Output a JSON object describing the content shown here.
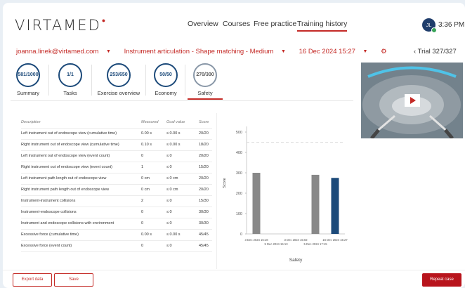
{
  "header": {
    "logo_text": "VIRTAMED",
    "nav": [
      "Overview",
      "Courses",
      "Free practice",
      "Training history"
    ],
    "avatar_initials": "JL",
    "time": "3:36 PM"
  },
  "breadcrumbs": {
    "user": "joanna.linek@virtamed.com",
    "exercise": "Instrument articulation - Shape matching - Medium",
    "date": "16 Dec 2024 15:27",
    "trial": "Trial 327/327"
  },
  "tabs": [
    {
      "value": "581/1000",
      "label": "Summary"
    },
    {
      "value": "1/1",
      "label": "Tasks"
    },
    {
      "value": "253/650",
      "label": "Exercise overview"
    },
    {
      "value": "50/50",
      "label": "Economy"
    },
    {
      "value": "270/300",
      "label": "Safety"
    }
  ],
  "table": {
    "headers": [
      "Description",
      "Measured",
      "Goal value",
      "Score"
    ],
    "rows": [
      [
        "Left instrument out of endoscope view (cumulative time)",
        "0.00 s",
        "≤ 0.00 s",
        "20/20"
      ],
      [
        "Right instrument out of endoscope view (cumulative time)",
        "0.10 s",
        "≤ 0.00 s",
        "18/20"
      ],
      [
        "Left instrument out of endoscope view (event count)",
        "0",
        "≤ 0",
        "20/20"
      ],
      [
        "Right instrument out of endoscope view (event count)",
        "1",
        "≤ 0",
        "15/20"
      ],
      [
        "Left instrument path length out of endoscope view",
        "0 cm",
        "≤ 0 cm",
        "20/20"
      ],
      [
        "Right instrument path length out of endoscope view",
        "0 cm",
        "≤ 0 cm",
        "20/20"
      ],
      [
        "Instrument-instrument collisions",
        "2",
        "≤ 0",
        "15/30"
      ],
      [
        "Instrument-endoscope collisions",
        "0",
        "≤ 0",
        "30/30"
      ],
      [
        "Instrument and endoscope collisions with environment",
        "0",
        "≤ 0",
        "30/30"
      ],
      [
        "Excessive force (cumulative time)",
        "0.00 s",
        "≤ 0.00 s",
        "45/45"
      ],
      [
        "Excessive force (event count)",
        "0",
        "≤ 0",
        "45/45"
      ]
    ]
  },
  "chart_data": {
    "type": "bar",
    "xlabel": "Safety",
    "ylabel": "Score",
    "ylim": [
      0,
      500
    ],
    "yticks": [
      0,
      100,
      200,
      300,
      400,
      500
    ],
    "xtick_labels_top": [
      "3 Dec 2024 15:18",
      "3 Dec 2024 15:02",
      "16 Dec 2024 15:27"
    ],
    "xtick_labels_bottom": [
      "5 Dec 2024 15:13",
      "5 Dec 2024 17:15"
    ],
    "values": [
      300,
      0,
      0,
      290,
      275
    ],
    "colors": [
      "#888888",
      "#888888",
      "#888888",
      "#888888",
      "#1c4a7a"
    ],
    "goal": 450
  },
  "buttons": {
    "export": "Export data",
    "save": "Save",
    "repeat": "Repeat case"
  },
  "colors": {
    "accent": "#c42a26",
    "navy": "#1c4a7a"
  }
}
